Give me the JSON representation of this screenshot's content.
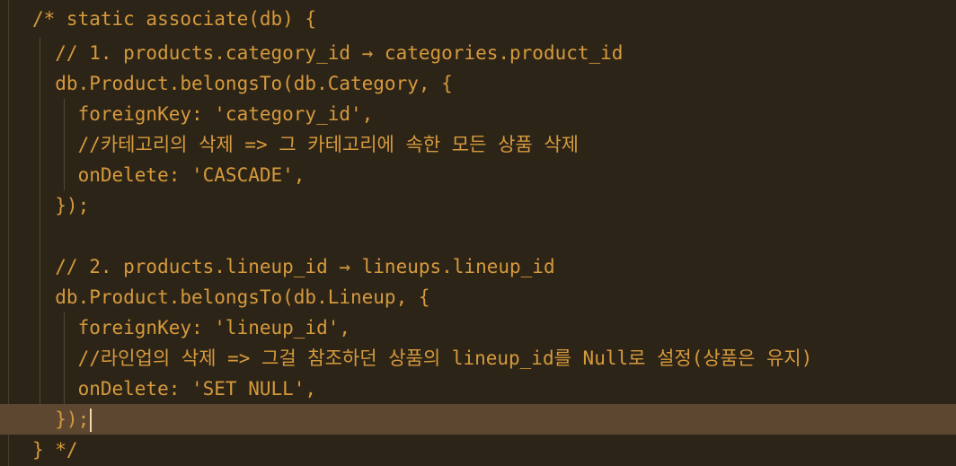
{
  "editor": {
    "lines": [
      "/* static associate(db) {",
      "  // 1. products.category_id → categories.product_id",
      "  db.Product.belongsTo(db.Category, {",
      "    foreignKey: 'category_id',",
      "    //카테고리의 삭제 => 그 카테고리에 속한 모든 상품 삭제",
      "    onDelete: 'CASCADE',",
      "  });",
      "",
      "  // 2. products.lineup_id → lineups.lineup_id",
      "  db.Product.belongsTo(db.Lineup, {",
      "    foreignKey: 'lineup_id',",
      "    //라인업의 삭제 => 그걸 참조하던 상품의 lineup_id를 Null로 설정(상품은 유지)",
      "    onDelete: 'SET NULL',",
      "  });",
      "} */"
    ],
    "current_line_index": 13
  }
}
